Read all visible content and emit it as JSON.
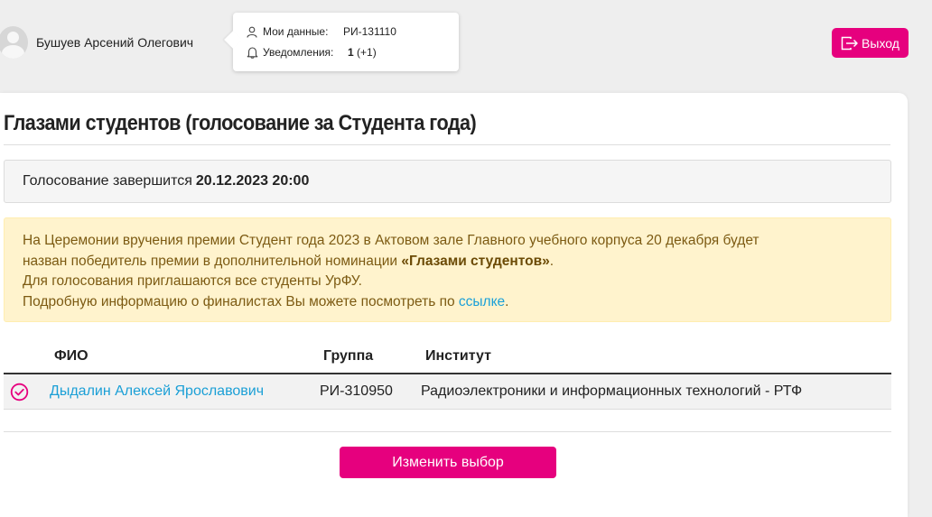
{
  "header": {
    "user_name": "Бушуев Арсений Олегович",
    "my_data_label": "Мои данные:",
    "my_data_value": "РИ-131110",
    "notifications_label": "Уведомления:",
    "notifications_count": "1",
    "notifications_new": "(+1)",
    "logout_label": "Выход"
  },
  "main": {
    "title": "Глазами студентов (голосование за Студента года)",
    "deadline_text": "Голосование завершится",
    "deadline_value": "20.12.2023 20:00",
    "notice": {
      "line1": "На Церемонии вручения премии Студент года 2023 в Актовом зале Главного учебного корпуса 20 декабря будет",
      "line2_prefix": "назван победитель премии в дополнительной номинации ",
      "line2_bold": "«Глазами студентов»",
      "line2_suffix": ".",
      "line3": "Для голосования приглашаются все студенты УрФУ.",
      "line4_prefix": "Подробную информацию о финалистах Вы можете посмотреть по ",
      "line4_link": "ссылке",
      "line4_suffix": "."
    },
    "table": {
      "columns": [
        "ФИО",
        "Группа",
        "Институт"
      ],
      "rows": [
        {
          "name": "Дыдалин Алексей Ярославович",
          "group": "РИ-310950",
          "institute": "Радиоэлектроники и информационных технологий - РТФ"
        }
      ]
    },
    "change_button_label": "Изменить выбор"
  },
  "colors": {
    "accent": "#e6007e",
    "link": "#1a9fd6",
    "notice_bg": "#fff3cd",
    "notice_text": "#7c5a12"
  }
}
